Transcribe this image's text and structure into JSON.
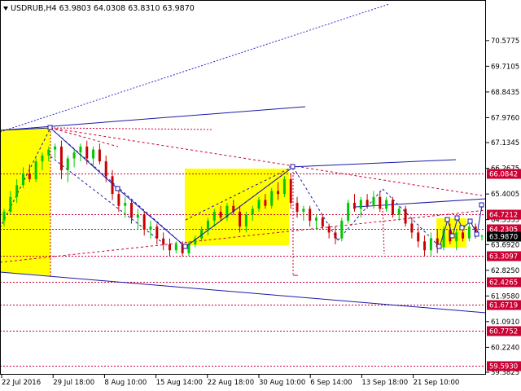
{
  "chart_data": {
    "type": "candlestick",
    "title": "USDRUB,H4  63.9803 64.0308 63.8310 63.9870",
    "symbol": "USDRUB",
    "timeframe": "H4",
    "ohlc": {
      "open": 63.9803,
      "high": 64.0308,
      "low": 63.831,
      "close": 63.987
    },
    "ylim": [
      59.3825,
      71.1775
    ],
    "y_ticks": [
      "70.5775",
      "69.7105",
      "68.8435",
      "67.9760",
      "67.1345",
      "66.2675",
      "65.4005",
      "64.5335",
      "63.6920",
      "62.8250",
      "61.9580",
      "61.0910",
      "60.2240",
      "59.3825"
    ],
    "x_ticks": [
      "22 Jul 2016",
      "29 Jul 18:00",
      "8 Aug 10:00",
      "15 Aug 14:00",
      "22 Aug 18:00",
      "30 Aug 10:00",
      "6 Sep 14:00",
      "13 Sep 18:00",
      "21 Sep 10:00"
    ],
    "colors": {
      "bull": "#00c800",
      "bear": "#c80000",
      "zone": "#ffff00",
      "channel": "#1a1aa8",
      "target": "#cc0033"
    },
    "price_levels": [
      {
        "label": "66.0842",
        "value": 66.0842,
        "bg": "#cc0033",
        "fg": "#ffffff"
      },
      {
        "label": "64.7212",
        "value": 64.7212,
        "bg": "#cc0033",
        "fg": "#ffffff"
      },
      {
        "label": "64.2305",
        "value": 64.2305,
        "bg": "#cc0033",
        "fg": "#ffffff"
      },
      {
        "label": "63.9870",
        "value": 63.987,
        "bg": "#000000",
        "fg": "#ffffff"
      },
      {
        "label": "63.3097",
        "value": 63.3097,
        "bg": "#cc0033",
        "fg": "#ffffff"
      },
      {
        "label": "62.4265",
        "value": 62.4265,
        "bg": "#cc0033",
        "fg": "#ffffff"
      },
      {
        "label": "61.6719",
        "value": 61.6719,
        "bg": "#cc0033",
        "fg": "#ffffff"
      },
      {
        "label": "60.7752",
        "value": 60.7752,
        "bg": "#cc0033",
        "fg": "#ffffff"
      },
      {
        "label": "59.5930",
        "value": 59.593,
        "bg": "#cc0033",
        "fg": "#ffffff"
      }
    ],
    "candles": [
      {
        "o": 64.5,
        "h": 64.9,
        "l": 64.3,
        "c": 64.8
      },
      {
        "o": 64.8,
        "h": 65.5,
        "l": 64.7,
        "c": 65.3
      },
      {
        "o": 65.3,
        "h": 65.9,
        "l": 65.1,
        "c": 65.7
      },
      {
        "o": 65.7,
        "h": 66.3,
        "l": 65.6,
        "c": 66.1
      },
      {
        "o": 66.1,
        "h": 66.4,
        "l": 65.8,
        "c": 65.9
      },
      {
        "o": 65.9,
        "h": 66.6,
        "l": 65.8,
        "c": 66.5
      },
      {
        "o": 66.5,
        "h": 66.8,
        "l": 66.2,
        "c": 66.7
      },
      {
        "o": 66.7,
        "h": 67.0,
        "l": 66.5,
        "c": 66.9
      },
      {
        "o": 66.9,
        "h": 67.1,
        "l": 66.6,
        "c": 67.0
      },
      {
        "o": 67.0,
        "h": 67.2,
        "l": 65.9,
        "c": 66.2
      },
      {
        "o": 66.2,
        "h": 66.7,
        "l": 65.8,
        "c": 66.6
      },
      {
        "o": 66.6,
        "h": 66.9,
        "l": 66.3,
        "c": 66.8
      },
      {
        "o": 66.8,
        "h": 67.1,
        "l": 66.5,
        "c": 67.0
      },
      {
        "o": 67.0,
        "h": 67.2,
        "l": 66.4,
        "c": 66.6
      },
      {
        "o": 66.6,
        "h": 67.0,
        "l": 66.3,
        "c": 66.9
      },
      {
        "o": 66.9,
        "h": 67.1,
        "l": 66.4,
        "c": 66.5
      },
      {
        "o": 66.5,
        "h": 66.7,
        "l": 65.8,
        "c": 66.0
      },
      {
        "o": 66.0,
        "h": 66.2,
        "l": 65.2,
        "c": 65.4
      },
      {
        "o": 65.4,
        "h": 65.6,
        "l": 64.8,
        "c": 65.0
      },
      {
        "o": 65.0,
        "h": 65.3,
        "l": 64.6,
        "c": 65.1
      },
      {
        "o": 65.1,
        "h": 65.2,
        "l": 64.4,
        "c": 64.6
      },
      {
        "o": 64.6,
        "h": 64.9,
        "l": 64.2,
        "c": 64.7
      },
      {
        "o": 64.7,
        "h": 64.8,
        "l": 64.0,
        "c": 64.2
      },
      {
        "o": 64.2,
        "h": 64.5,
        "l": 63.9,
        "c": 64.3
      },
      {
        "o": 64.3,
        "h": 64.4,
        "l": 63.7,
        "c": 63.9
      },
      {
        "o": 63.9,
        "h": 64.1,
        "l": 63.5,
        "c": 63.7
      },
      {
        "o": 63.7,
        "h": 63.9,
        "l": 63.3,
        "c": 63.5
      },
      {
        "o": 63.5,
        "h": 63.8,
        "l": 63.4,
        "c": 63.7
      },
      {
        "o": 63.7,
        "h": 63.8,
        "l": 63.3,
        "c": 63.4
      },
      {
        "o": 63.4,
        "h": 63.8,
        "l": 63.3,
        "c": 63.7
      },
      {
        "o": 63.7,
        "h": 64.0,
        "l": 63.6,
        "c": 63.9
      },
      {
        "o": 63.9,
        "h": 64.3,
        "l": 63.8,
        "c": 64.2
      },
      {
        "o": 64.2,
        "h": 64.6,
        "l": 64.0,
        "c": 64.5
      },
      {
        "o": 64.5,
        "h": 64.9,
        "l": 64.3,
        "c": 64.8
      },
      {
        "o": 64.8,
        "h": 65.0,
        "l": 64.5,
        "c": 64.6
      },
      {
        "o": 64.6,
        "h": 65.1,
        "l": 64.5,
        "c": 65.0
      },
      {
        "o": 65.0,
        "h": 65.2,
        "l": 64.7,
        "c": 64.8
      },
      {
        "o": 64.8,
        "h": 65.0,
        "l": 64.1,
        "c": 64.3
      },
      {
        "o": 64.3,
        "h": 64.8,
        "l": 64.1,
        "c": 64.7
      },
      {
        "o": 64.7,
        "h": 65.0,
        "l": 64.5,
        "c": 64.9
      },
      {
        "o": 64.9,
        "h": 65.3,
        "l": 64.8,
        "c": 65.2
      },
      {
        "o": 65.2,
        "h": 65.4,
        "l": 64.9,
        "c": 65.0
      },
      {
        "o": 65.0,
        "h": 65.6,
        "l": 64.9,
        "c": 65.5
      },
      {
        "o": 65.5,
        "h": 65.8,
        "l": 65.2,
        "c": 65.4
      },
      {
        "o": 65.4,
        "h": 66.0,
        "l": 65.3,
        "c": 65.9
      },
      {
        "o": 65.9,
        "h": 66.1,
        "l": 64.9,
        "c": 65.1
      },
      {
        "o": 65.1,
        "h": 65.3,
        "l": 64.6,
        "c": 64.8
      },
      {
        "o": 64.8,
        "h": 65.0,
        "l": 64.5,
        "c": 64.9
      },
      {
        "o": 64.9,
        "h": 65.0,
        "l": 64.3,
        "c": 64.5
      },
      {
        "o": 64.5,
        "h": 64.7,
        "l": 64.2,
        "c": 64.6
      },
      {
        "o": 64.6,
        "h": 64.7,
        "l": 64.2,
        "c": 64.3
      },
      {
        "o": 64.3,
        "h": 64.4,
        "l": 63.9,
        "c": 64.1
      },
      {
        "o": 64.1,
        "h": 64.3,
        "l": 63.7,
        "c": 63.9
      },
      {
        "o": 63.9,
        "h": 64.6,
        "l": 63.8,
        "c": 64.5
      },
      {
        "o": 64.5,
        "h": 65.2,
        "l": 64.4,
        "c": 65.1
      },
      {
        "o": 65.1,
        "h": 65.4,
        "l": 64.8,
        "c": 64.9
      },
      {
        "o": 64.9,
        "h": 65.3,
        "l": 64.6,
        "c": 65.2
      },
      {
        "o": 65.2,
        "h": 65.4,
        "l": 64.9,
        "c": 65.0
      },
      {
        "o": 65.0,
        "h": 65.5,
        "l": 64.9,
        "c": 65.3
      },
      {
        "o": 65.3,
        "h": 65.5,
        "l": 64.8,
        "c": 64.9
      },
      {
        "o": 64.9,
        "h": 65.3,
        "l": 64.8,
        "c": 65.2
      },
      {
        "o": 65.2,
        "h": 65.3,
        "l": 64.6,
        "c": 64.7
      },
      {
        "o": 64.7,
        "h": 65.0,
        "l": 64.5,
        "c": 64.9
      },
      {
        "o": 64.9,
        "h": 65.0,
        "l": 64.3,
        "c": 64.4
      },
      {
        "o": 64.4,
        "h": 64.6,
        "l": 63.9,
        "c": 64.1
      },
      {
        "o": 64.1,
        "h": 64.3,
        "l": 63.6,
        "c": 63.8
      },
      {
        "o": 63.8,
        "h": 64.0,
        "l": 63.3,
        "c": 63.5
      },
      {
        "o": 63.5,
        "h": 64.1,
        "l": 63.3,
        "c": 63.9
      },
      {
        "o": 63.9,
        "h": 64.2,
        "l": 63.4,
        "c": 63.6
      },
      {
        "o": 63.6,
        "h": 64.3,
        "l": 63.5,
        "c": 64.2
      },
      {
        "o": 64.2,
        "h": 64.4,
        "l": 63.7,
        "c": 63.8
      },
      {
        "o": 63.8,
        "h": 64.2,
        "l": 63.5,
        "c": 64.1
      },
      {
        "o": 64.1,
        "h": 64.3,
        "l": 63.8,
        "c": 63.9
      },
      {
        "o": 63.9,
        "h": 64.5,
        "l": 63.8,
        "c": 64.3
      },
      {
        "o": 64.3,
        "h": 64.4,
        "l": 63.9,
        "c": 64.0
      },
      {
        "o": 63.98,
        "h": 64.03,
        "l": 63.83,
        "c": 63.99
      }
    ]
  }
}
